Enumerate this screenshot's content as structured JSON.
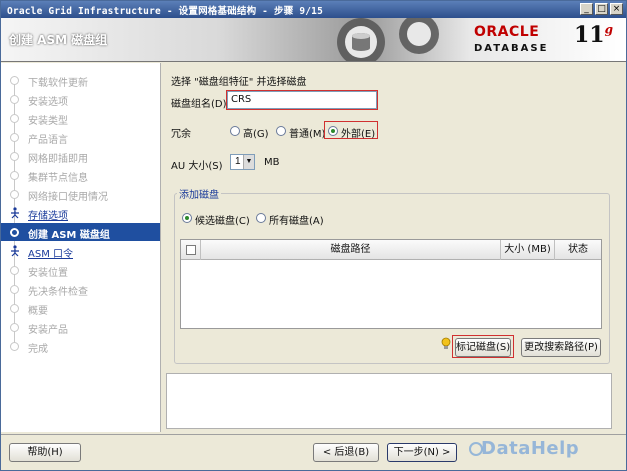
{
  "window": {
    "title": "Oracle Grid Infrastructure - 设置网格基础结构 - 步骤 9/15",
    "controls": {
      "minimize": "_",
      "maximize": "□",
      "close": "×"
    }
  },
  "header": {
    "page_title": "创建 ASM 磁盘组",
    "logo": {
      "brand": "ORACLE",
      "product": "DATABASE",
      "version": "11",
      "version_sup": "g"
    }
  },
  "nav": {
    "items": [
      {
        "label": "下载软件更新",
        "state": "done"
      },
      {
        "label": "安装选项",
        "state": "done"
      },
      {
        "label": "安装类型",
        "state": "done"
      },
      {
        "label": "产品语言",
        "state": "done"
      },
      {
        "label": "网格即插即用",
        "state": "done"
      },
      {
        "label": "集群节点信息",
        "state": "done"
      },
      {
        "label": "网络接口使用情况",
        "state": "done"
      },
      {
        "label": "存储选项",
        "state": "link"
      },
      {
        "label": "创建 ASM 磁盘组",
        "state": "active"
      },
      {
        "label": "ASM 口令",
        "state": "link"
      },
      {
        "label": "安装位置",
        "state": "pending"
      },
      {
        "label": "先决条件检查",
        "state": "pending"
      },
      {
        "label": "概要",
        "state": "pending"
      },
      {
        "label": "安装产品",
        "state": "pending"
      },
      {
        "label": "完成",
        "state": "pending"
      }
    ]
  },
  "form": {
    "instruction": "选择 \"磁盘组特征\" 并选择磁盘",
    "diskgroup_name_label": "磁盘组名(D)",
    "diskgroup_name_value": "CRS",
    "redundancy_label": "冗余",
    "redundancy_options": [
      "高(G)",
      "普通(M)",
      "外部(E)"
    ],
    "redundancy_selected": "外部(E)",
    "au_size_label": "AU 大小(S)",
    "au_size_value": "1",
    "au_size_unit": "MB"
  },
  "add_disks": {
    "legend": "添加磁盘",
    "filter_options": [
      "候选磁盘(C)",
      "所有磁盘(A)"
    ],
    "filter_selected": "候选磁盘(C)",
    "columns": [
      "磁盘路径",
      "大小 (MB)",
      "状态"
    ],
    "rows": [],
    "stamp_disk_button": "标记磁盘(S)",
    "change_discovery_button": "更改搜索路径(P)"
  },
  "footer": {
    "help_button": "帮助(H)",
    "back_button": "< 后退(B)",
    "next_button": "下一步(N) >",
    "watermark": "DataHelp"
  }
}
